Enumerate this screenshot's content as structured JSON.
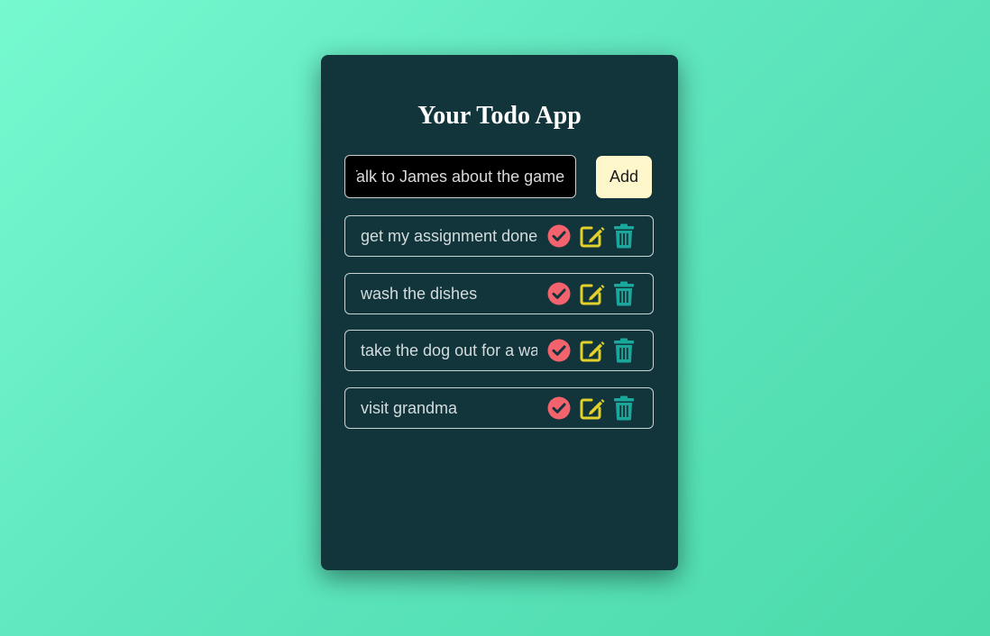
{
  "app": {
    "title": "Your Todo App"
  },
  "input": {
    "value": "Talk to James about the game",
    "placeholder": ""
  },
  "add_button": {
    "label": "Add"
  },
  "todos": [
    {
      "text": "get my assignment done"
    },
    {
      "text": "wash the dishes"
    },
    {
      "text": "take the dog out for a walk"
    },
    {
      "text": "visit grandma"
    }
  ],
  "icons": {
    "complete": "check-circle-icon",
    "edit": "pen-square-icon",
    "delete": "trash-icon"
  },
  "colors": {
    "background_start": "#76f9cf",
    "background_end": "#4bdaa9",
    "card": "#12343b",
    "complete_icon": "#f2636e",
    "edit_icon": "#e3d12b",
    "delete_icon": "#1aa79c",
    "add_button": "#fff7cc"
  }
}
